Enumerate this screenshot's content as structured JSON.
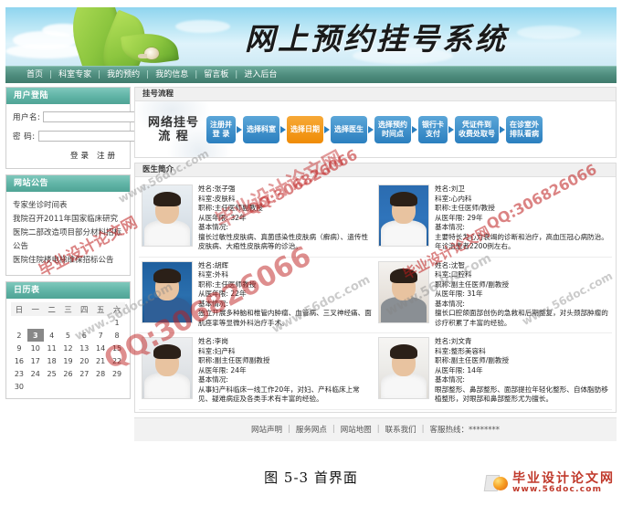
{
  "header": {
    "site_title": "网上预约挂号系统",
    "nav": [
      "首页",
      "科室专家",
      "我的预约",
      "我的信息",
      "留言板",
      "进入后台"
    ]
  },
  "sidebar": {
    "login": {
      "title": "用户登陆",
      "username_label": "用户名:",
      "username_value": "",
      "password_label": "密  码:",
      "password_value": "",
      "login_button": "登录",
      "register_button": "注册"
    },
    "notice": {
      "title": "网站公告",
      "items": [
        "专家坐诊时间表",
        "我院召开2011年国家临床研究",
        "医院二部改造项目部分材料招标公告",
        "医院住院楼电梯维保招标公告"
      ]
    },
    "calendar": {
      "title": "日历表",
      "weekdays": [
        "日",
        "一",
        "二",
        "三",
        "四",
        "五",
        "六"
      ],
      "weeks": [
        [
          "",
          "",
          "",
          "",
          "",
          "",
          "1"
        ],
        [
          "2",
          "3",
          "4",
          "5",
          "6",
          "7",
          "8"
        ],
        [
          "9",
          "10",
          "11",
          "12",
          "13",
          "14",
          "15"
        ],
        [
          "16",
          "17",
          "18",
          "19",
          "20",
          "21",
          "22"
        ],
        [
          "23",
          "24",
          "25",
          "26",
          "27",
          "28",
          "29"
        ],
        [
          "30",
          "",
          "",
          "",
          "",
          "",
          ""
        ]
      ],
      "today": "3"
    }
  },
  "flow": {
    "panel_title": "挂号流程",
    "title": "网络挂号\n流 程",
    "title_line1": "网络挂号",
    "title_line2": "流 程",
    "steps": [
      {
        "label": "注册并\n登 录",
        "active": false
      },
      {
        "label": "选择科室",
        "active": false
      },
      {
        "label": "选择日期",
        "active": true
      },
      {
        "label": "选择医生",
        "active": false
      },
      {
        "label": "选择预约\n时间点",
        "active": false
      },
      {
        "label": "银行卡\n支付",
        "active": false
      },
      {
        "label": "凭证件到\n收费处取号",
        "active": false
      },
      {
        "label": "在诊室外\n排队看病",
        "active": false
      }
    ]
  },
  "doctors": {
    "panel_title": "医生简介",
    "labels": {
      "name": "姓名:",
      "dept": "科室:",
      "title": "职称:",
      "years": "从医年限:",
      "basic": "基本情况:"
    },
    "list": [
      {
        "name": "张子强",
        "dept": "皮肤科",
        "title": "主任医师副教授",
        "years": "32年",
        "desc": "擅长过敏性皮肤病、真菌感染性皮肤病（癣病）、遗传性皮肤病、大疱性皮肤病等的诊治。"
      },
      {
        "name": "刘卫",
        "dept": "心内科",
        "title": "主任医师/教授",
        "years": "29年",
        "desc": "主要特长为心力衰竭的诊断和治疗，高血压冠心病防治。年诊治患者2200例左右。"
      },
      {
        "name": "胡辉",
        "dept": "外科",
        "title": "主任医师教授",
        "years": "22年",
        "desc": "独立开展多种脑和椎管内肿瘤、血管病、三叉神经痛、面肌痉挛等显微外科治疗手术。"
      },
      {
        "name": "沈智",
        "dept": "口腔科",
        "title": "副主任医师/副教授",
        "years": "31年",
        "desc": "擅长口腔颌面部创伤的急救和后期整复，对头颈部肿瘤的诊疗积累了丰富的经验。"
      },
      {
        "name": "李岗",
        "dept": "妇产科",
        "title": "副主任医师副教授",
        "years": "24年",
        "desc": "从事妇产科临床一线工作20年，对妇、产科临床上常见、疑难病症及各类手术有丰富的经验。"
      },
      {
        "name": "刘文青",
        "dept": "整形美容科",
        "title": "副主任医师/副教授",
        "years": "14年",
        "desc": "眼部整形、鼻部整形、面部提拉年轻化整形、自体脂肪移植整形，对眼部和鼻部整形尤为擅长。"
      }
    ]
  },
  "footer": {
    "links": [
      "网站声明",
      "服务网点",
      "网站地图",
      "联系我们"
    ],
    "hotline": "客服热线：********"
  },
  "caption": "图 5-3 首界面",
  "logo": {
    "name": "毕业设计论文网",
    "url": "www.56doc.com"
  },
  "watermarks": [
    "毕业设计论文网",
    "www.56doc.com",
    "QQ:306826066"
  ]
}
